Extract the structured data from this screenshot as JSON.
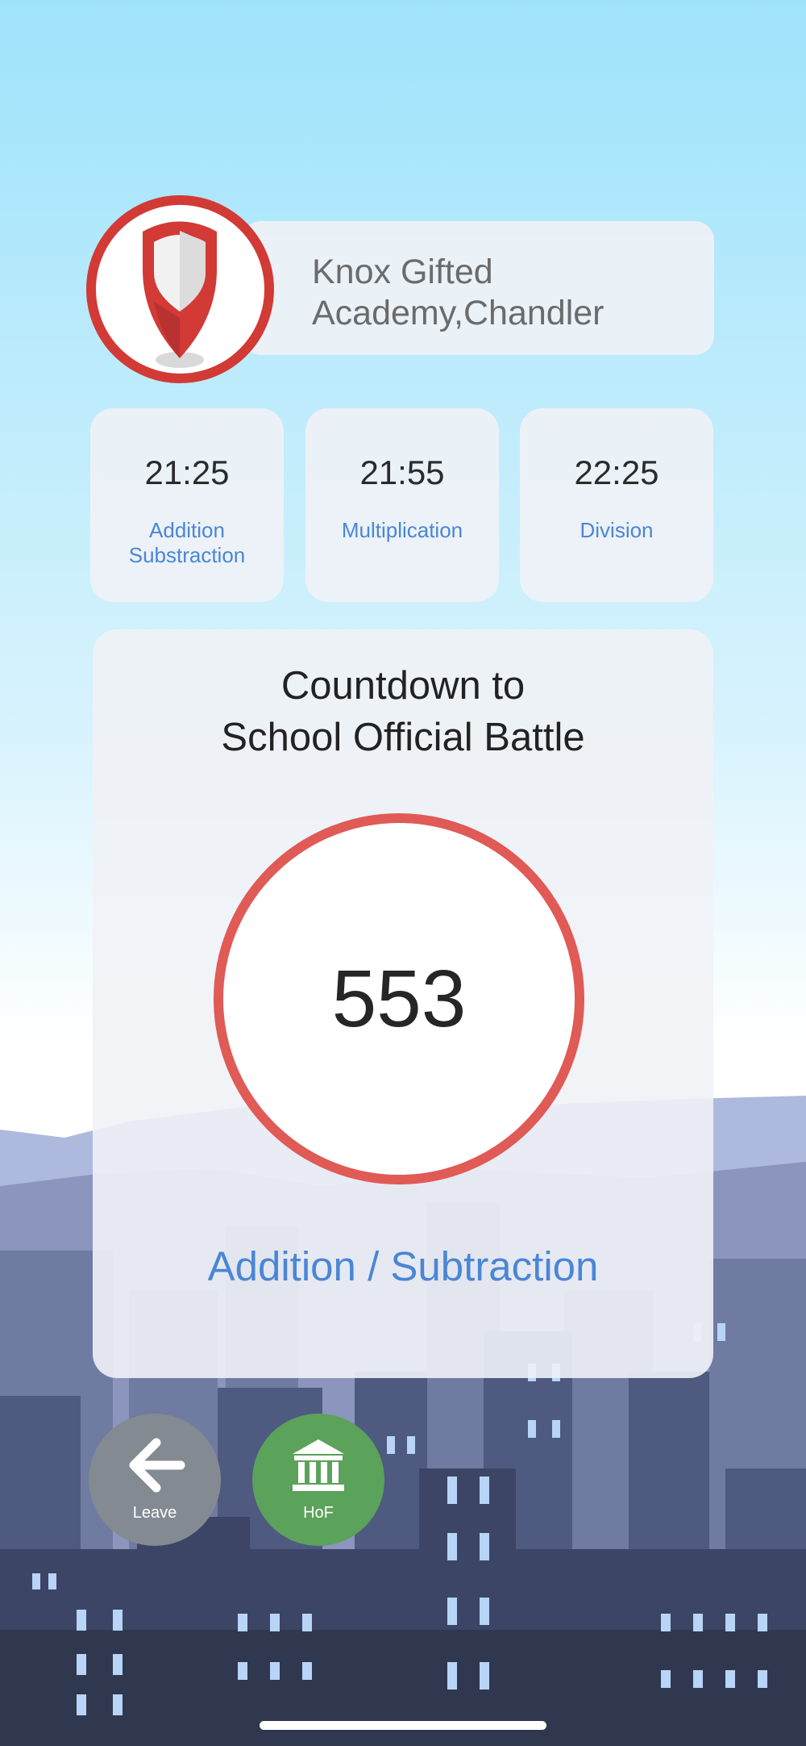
{
  "school": {
    "name_line1": "Knox Gifted",
    "name_line2": "Academy,Chandler"
  },
  "schedule": [
    {
      "time": "21:25",
      "op_line1": "Addition",
      "op_line2": "Substraction"
    },
    {
      "time": "21:55",
      "op_line1": "Multiplication",
      "op_line2": ""
    },
    {
      "time": "22:25",
      "op_line1": "Division",
      "op_line2": ""
    }
  ],
  "countdown": {
    "title_line1": "Countdown to",
    "title_line2": "School Official Battle",
    "value": "553",
    "mode": "Addition / Subtraction"
  },
  "buttons": {
    "leave": "Leave",
    "hof": "HoF"
  },
  "icons": {
    "badge": "shield-pin-icon",
    "leave": "arrow-left-icon",
    "hof": "bank-icon"
  },
  "colors": {
    "accent_red": "#e05a56",
    "badge_red": "#d23a36",
    "link_blue": "#4a86d6",
    "hof_green": "#5ba25a",
    "leave_gray": "#838a91"
  }
}
